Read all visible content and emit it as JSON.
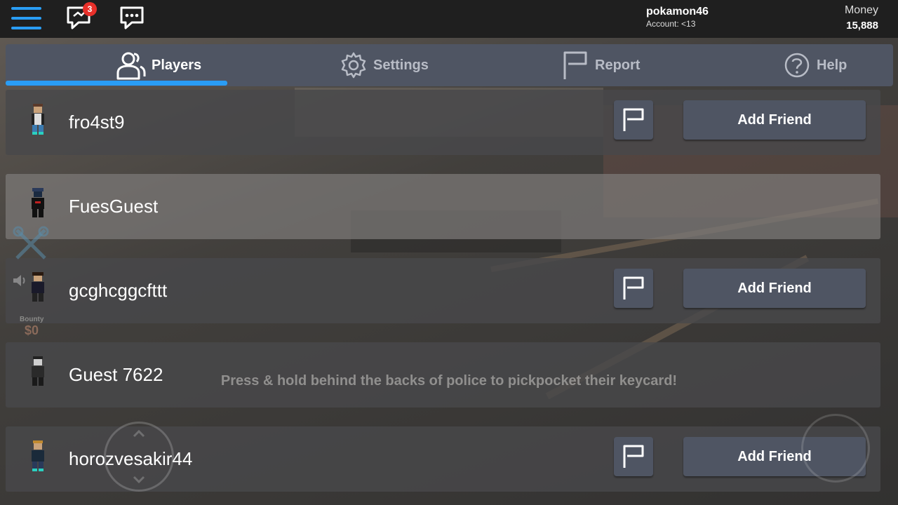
{
  "topbar": {
    "notification_count": "3",
    "username": "pokamon46",
    "account_label": "Account: <13",
    "money_label": "Money",
    "money_value": "15,888"
  },
  "tabs": [
    {
      "label": "Players",
      "icon": "players-icon",
      "active": true
    },
    {
      "label": "Settings",
      "icon": "gear-icon",
      "active": false
    },
    {
      "label": "Report",
      "icon": "flag-icon",
      "active": false
    },
    {
      "label": "Help",
      "icon": "question-icon",
      "active": false
    }
  ],
  "players": [
    {
      "name": "fro4st9",
      "has_actions": true
    },
    {
      "name": "FuesGuest",
      "has_actions": false
    },
    {
      "name": "gcghcggcfttt",
      "has_actions": true
    },
    {
      "name": "Guest 7622",
      "has_actions": false
    },
    {
      "name": "horozvesakir44",
      "has_actions": true
    }
  ],
  "actions": {
    "add_friend_label": "Add Friend"
  },
  "hint": "Press & hold behind the backs of police to pickpocket their keycard!",
  "bounty": {
    "label": "Bounty",
    "value": "$0"
  },
  "colors": {
    "accent": "#2a9df4",
    "panel": "#4f5563",
    "badge": "#e8302a"
  }
}
